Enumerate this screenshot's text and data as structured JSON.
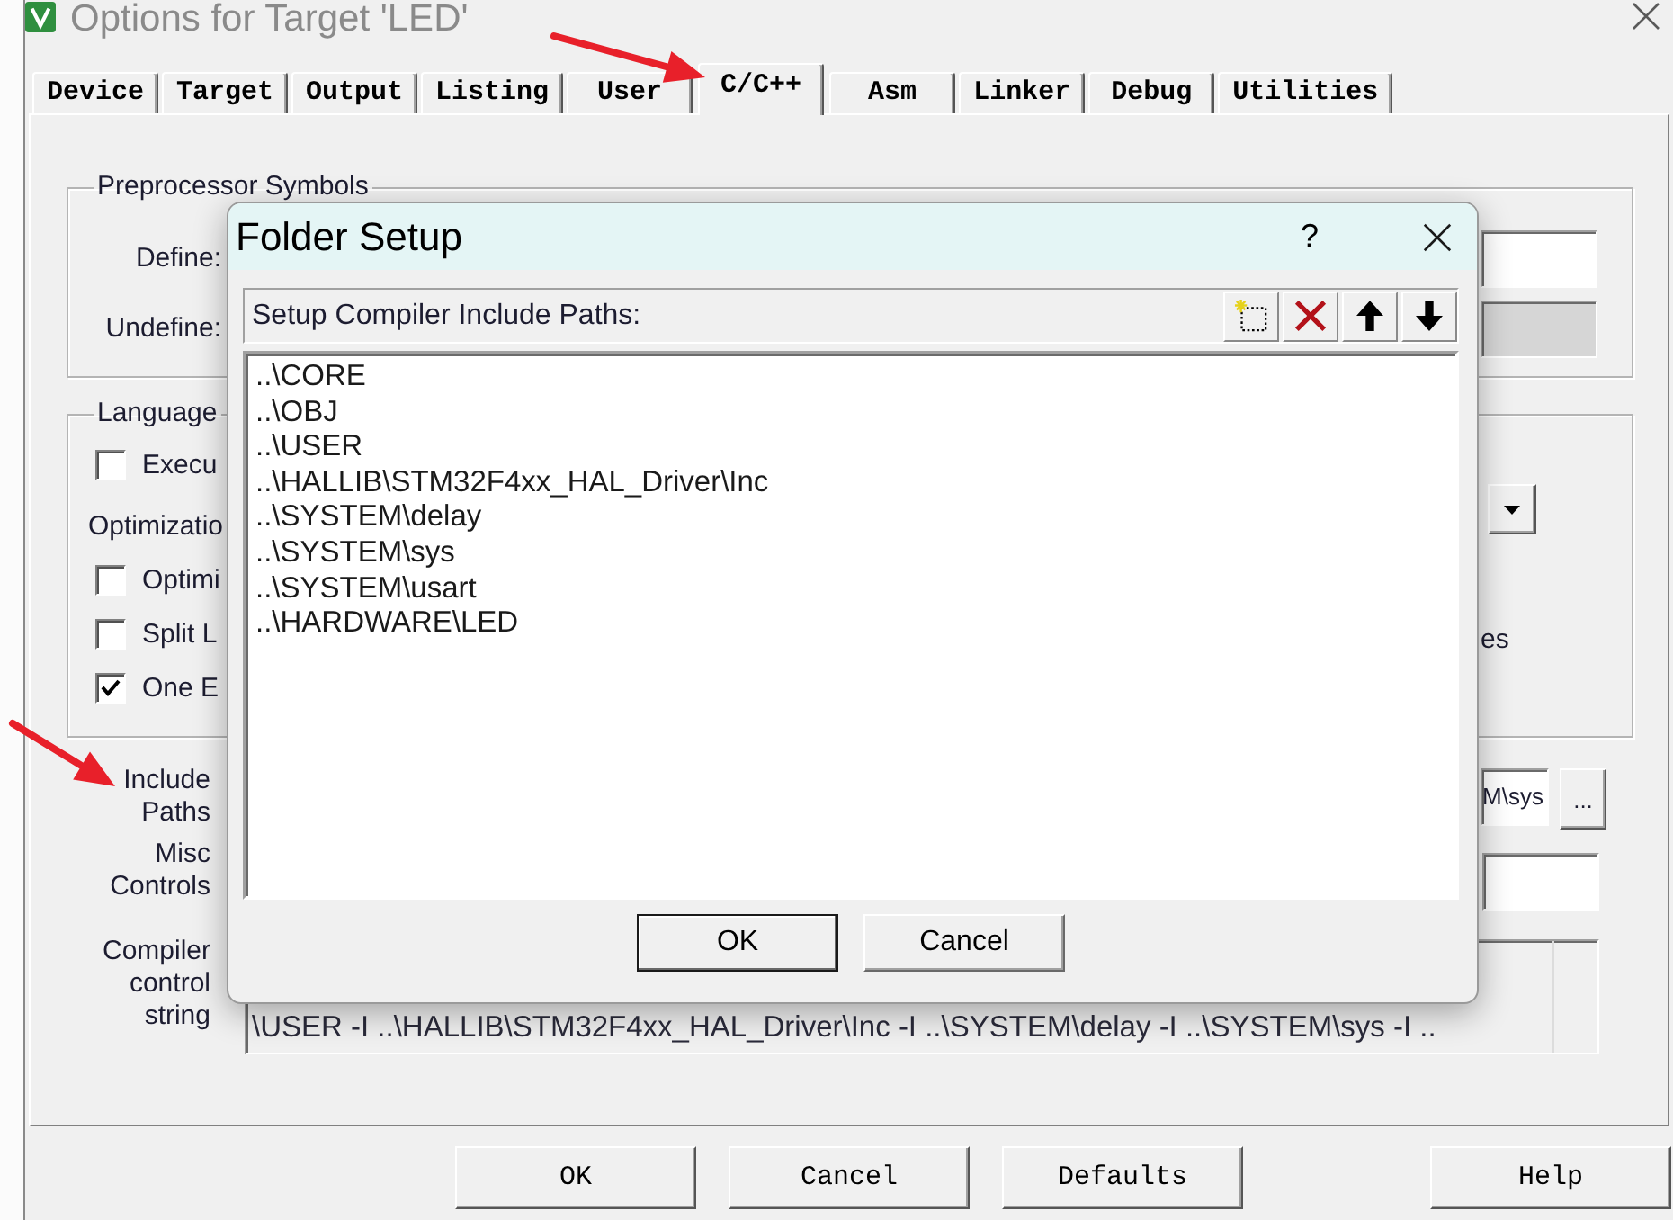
{
  "window": {
    "title": "Options for Target 'LED'"
  },
  "tabs": [
    {
      "label": "Device",
      "selected": false
    },
    {
      "label": "Target",
      "selected": false
    },
    {
      "label": "Output",
      "selected": false
    },
    {
      "label": "Listing",
      "selected": false
    },
    {
      "label": "User",
      "selected": false
    },
    {
      "label": "C/C++",
      "selected": true
    },
    {
      "label": "Asm",
      "selected": false
    },
    {
      "label": "Linker",
      "selected": false
    },
    {
      "label": "Debug",
      "selected": false
    },
    {
      "label": "Utilities",
      "selected": false
    }
  ],
  "preprocessor_symbols": {
    "title": "Preprocessor Symbols",
    "fields": [
      {
        "label": "Define:",
        "disabled": false
      },
      {
        "label": "Undefine:",
        "disabled": true
      }
    ]
  },
  "language_code_generation": {
    "title": "Language",
    "options": [
      {
        "kind": "checkbox",
        "label": "Execu",
        "checked": false
      },
      {
        "kind": "label",
        "label": "Optimizatio"
      },
      {
        "kind": "checkbox",
        "label": "Optimi",
        "checked": false
      },
      {
        "kind": "checkbox",
        "label": "Split L",
        "checked": false
      },
      {
        "kind": "checkbox",
        "label": "One E",
        "checked": true
      }
    ],
    "option_fragment": "es"
  },
  "include_paths": {
    "label": "Include Paths",
    "value": "M\\sys",
    "browse_button": "..."
  },
  "misc_controls": {
    "label": "Misc Controls"
  },
  "compiler_control_string": {
    "label": "Compiler control string",
    "value": "\\USER -I ..\\HALLIB\\STM32F4xx_HAL_Driver\\Inc -I ..\\SYSTEM\\delay -I ..\\SYSTEM\\sys -I .."
  },
  "buttons": [
    "OK",
    "Cancel",
    "Defaults",
    "Help"
  ],
  "folder_setup": {
    "title": "Folder Setup",
    "help_button": "?",
    "list_label": "Setup Compiler Include Paths:",
    "paths": [
      {
        "text": "..\\CORE",
        "selected": false
      },
      {
        "text": "..\\OBJ",
        "selected": false
      },
      {
        "text": "..\\USER",
        "selected": false
      },
      {
        "text": "..\\HALLIB\\STM32F4xx_HAL_Driver\\Inc",
        "selected": false
      },
      {
        "text": "..\\SYSTEM\\delay",
        "selected": false
      },
      {
        "text": "..\\SYSTEM\\sys",
        "selected": false
      },
      {
        "text": "..\\SYSTEM\\usart",
        "selected": false
      },
      {
        "text": "..\\HARDWARE\\LED",
        "selected": false
      }
    ],
    "buttons": [
      {
        "label": "OK",
        "default": true
      },
      {
        "label": "Cancel",
        "default": false
      }
    ]
  }
}
